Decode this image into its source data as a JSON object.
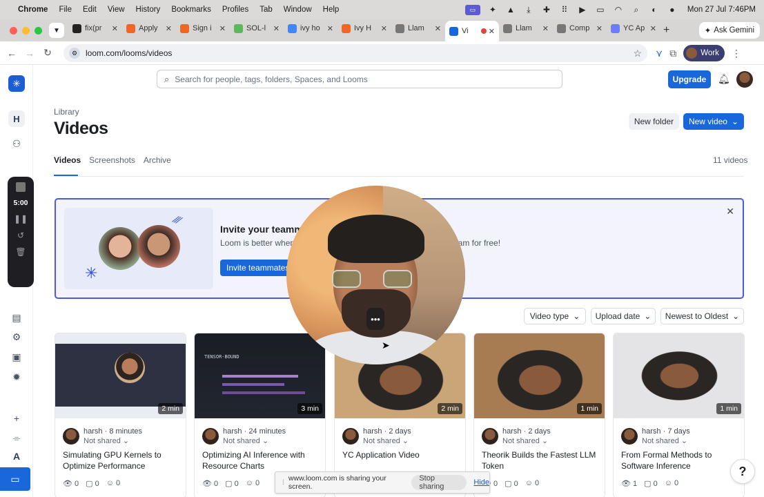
{
  "menubar": {
    "app": "Chrome",
    "items": [
      "File",
      "Edit",
      "View",
      "History",
      "Bookmarks",
      "Profiles",
      "Tab",
      "Window",
      "Help"
    ],
    "clock": "Mon 27 Jul  7:46PM"
  },
  "tabs": [
    {
      "label": "fix(pr",
      "icon": "github-icon",
      "color": "#222222"
    },
    {
      "label": "Apply",
      "icon": "ycombinator-icon",
      "color": "#f26522"
    },
    {
      "label": "Sign i",
      "icon": "ycombinator-icon",
      "color": "#f26522"
    },
    {
      "label": "SOL-l",
      "icon": "linear-icon",
      "color": "#5cb85c"
    },
    {
      "label": "ivy ho",
      "icon": "google-icon",
      "color": "#4285f4"
    },
    {
      "label": "Ivy H",
      "icon": "ycombinator-icon",
      "color": "#f26522"
    },
    {
      "label": "Llam",
      "icon": "globe-icon",
      "color": "#777777"
    },
    {
      "label": "Vi",
      "icon": "loom-icon",
      "color": "#1868db",
      "active": true
    },
    {
      "label": "Llam",
      "icon": "globe-icon",
      "color": "#777777"
    },
    {
      "label": "Comp",
      "icon": "globe-icon",
      "color": "#777777"
    },
    {
      "label": "YC Ap",
      "icon": "gemini-icon",
      "color": "#6b7cff"
    }
  ],
  "gemini": {
    "label": "Ask Gemini"
  },
  "address": {
    "url": "loom.com/looms/videos"
  },
  "profile": {
    "label": "Work"
  },
  "search": {
    "placeholder": "Search for people, tags, folders, Spaces, and Looms"
  },
  "header": {
    "upgrade": "Upgrade"
  },
  "sidebar": {
    "workspace_initial": "H",
    "recording_timer": "5:00"
  },
  "page": {
    "breadcrumb": "Library",
    "title": "Videos",
    "new_folder": "New folder",
    "new_video": "New video",
    "tabs": [
      "Videos",
      "Screenshots",
      "Archive"
    ],
    "count": "11 videos"
  },
  "banner": {
    "title": "Invite your teamm",
    "subtitle": "Loom is better when",
    "subtitle_tail": "eam for free!",
    "button": "Invite teammates"
  },
  "filters": {
    "video_type": "Video type",
    "upload_date": "Upload date",
    "sort": "Newest to Oldest"
  },
  "videos": [
    {
      "duration": "2 min",
      "author": "harsh",
      "time": "8 minutes",
      "shared": "Not shared",
      "title": "Simulating GPU Kernels to Optimize Performance",
      "views": "0",
      "comments": "0",
      "reactions": "0"
    },
    {
      "duration": "3 min",
      "author": "harsh",
      "time": "24 minutes",
      "shared": "Not shared",
      "title": "Optimizing AI Inference with Resource Charts",
      "views": "0",
      "comments": "0",
      "reactions": "0"
    },
    {
      "duration": "2 min",
      "author": "harsh",
      "time": "2 days",
      "shared": "Not shared",
      "title": "YC Application Video",
      "views": "",
      "comments": "",
      "reactions": ""
    },
    {
      "duration": "1 min",
      "author": "harsh",
      "time": "2 days",
      "shared": "Not shared",
      "title": "Theorik Builds the Fastest LLM Token",
      "views": "0",
      "comments": "0",
      "reactions": "0"
    },
    {
      "duration": "1 min",
      "author": "harsh",
      "time": "7 days",
      "shared": "Not shared",
      "title": "From Formal Methods to Software Inference",
      "views": "1",
      "comments": "0",
      "reactions": "0"
    }
  ],
  "thumb_labels": {
    "tensor": "TENSOR-BOUND"
  },
  "sharebar": {
    "message": "www.loom.com is sharing your screen.",
    "stop": "Stop sharing",
    "hide": "Hide"
  },
  "help": {
    "label": "?"
  },
  "colors": {
    "accent": "#1868db",
    "banner_border": "#4b5be0"
  }
}
